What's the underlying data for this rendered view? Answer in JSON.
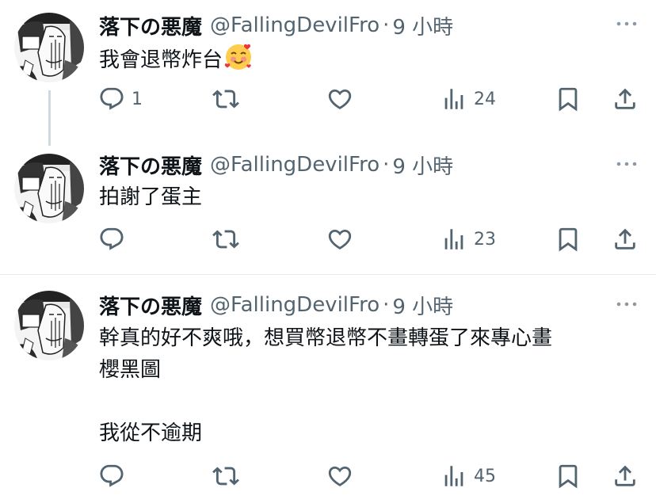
{
  "tweets": [
    {
      "author_name": "落下の悪魔",
      "author_handle": "@FallingDevilFro",
      "separator": "·",
      "time": "9 小時",
      "text": "我會退幣炸台",
      "emoji": "smiling-face-with-hearts-emoji",
      "replies": "1",
      "retweets": "",
      "likes": "",
      "views": "24"
    },
    {
      "author_name": "落下の悪魔",
      "author_handle": "@FallingDevilFro",
      "separator": "·",
      "time": "9 小時",
      "text": "拍謝了蛋主",
      "replies": "",
      "retweets": "",
      "likes": "",
      "views": "23"
    },
    {
      "author_name": "落下の悪魔",
      "author_handle": "@FallingDevilFro",
      "separator": "·",
      "time": "9 小時",
      "text": "幹真的好不爽哦，想買幣退幣不畫轉蛋了來專心畫\n櫻黑圖\n\n我從不逾期",
      "replies": "",
      "retweets": "",
      "likes": "",
      "views": "45"
    }
  ],
  "icons": {
    "reply": "reply-icon",
    "retweet": "retweet-icon",
    "like": "heart-icon",
    "views": "views-icon",
    "bookmark": "bookmark-icon",
    "share": "share-icon",
    "more": "more-icon"
  },
  "colors": {
    "text": "#0f1419",
    "secondary": "#536471",
    "thread_line": "#cfd9de",
    "divider": "#e6ecf0"
  }
}
